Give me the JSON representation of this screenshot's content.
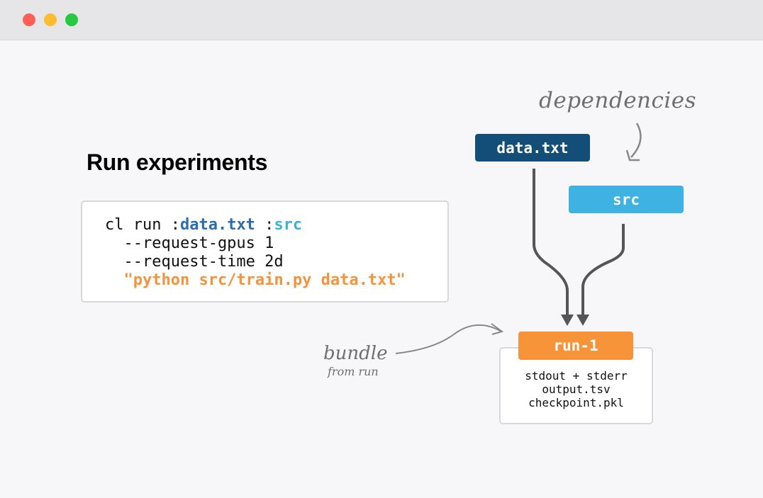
{
  "window": {
    "controls": [
      "close",
      "minimize",
      "maximize"
    ]
  },
  "heading": "Run experiments",
  "code": {
    "line1_cmd": "cl run ",
    "line1_colon1": ":",
    "line1_data": "data.txt",
    "line1_sep": " :",
    "line1_src": "src",
    "line2": "  --request-gpus 1",
    "line3": "  --request-time 2d",
    "line4_indent": "  ",
    "line4_str": "\"python src/train.py data.txt\""
  },
  "diagram": {
    "dependency_label": "dependencies",
    "bundle_label": "bundle",
    "bundle_sublabel": "from run",
    "nodes": {
      "data": "data.txt",
      "src": "src",
      "run": "run-1"
    },
    "outputs": [
      "stdout + stderr",
      "output.tsv",
      "checkpoint.pkl"
    ]
  },
  "colors": {
    "data": "#134e79",
    "src": "#3db2e3",
    "run": "#f7943a",
    "string": "#f5923e",
    "arrow": "#555555"
  }
}
